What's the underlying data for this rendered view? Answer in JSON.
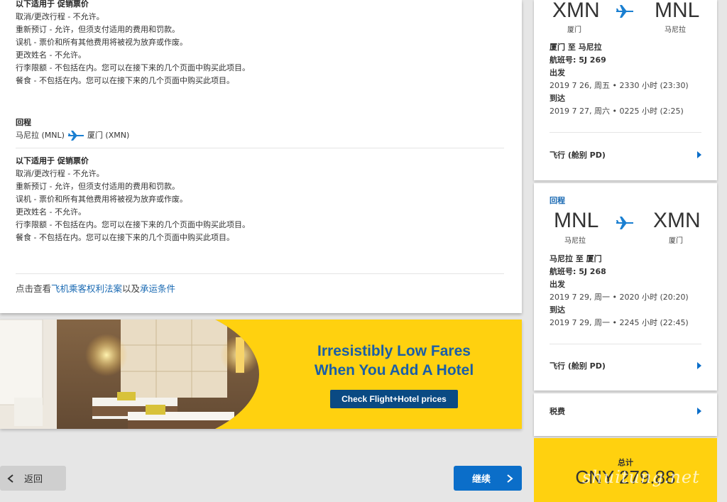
{
  "outbound_rules": {
    "title": "以下适用于 促销票价",
    "lines": [
      "取消/更改行程 - 不允许。",
      "重新预订 - 允许，但须支付适用的费用和罚款。",
      "误机 - 票价和所有其他费用将被视为放弃或作废。",
      "更改姓名 - 不允许。",
      "行李限额 - 不包括在内。您可以在接下来的几个页面中购买此项目。",
      "餐食 - 不包括在内。您可以在接下来的几个页面中购买此项目。"
    ]
  },
  "return_leg": {
    "title": "回程",
    "from": "马尼拉 (MNL)",
    "to": "厦门 (XMN)"
  },
  "return_rules": {
    "title": "以下适用于 促销票价",
    "lines": [
      "取消/更改行程 - 不允许。",
      "重新预订 - 允许，但须支付适用的费用和罚款。",
      "误机 - 票价和所有其他费用将被视为放弃或作废。",
      "更改姓名 - 不允许。",
      "行李限额 - 不包括在内。您可以在接下来的几个页面中购买此项目。",
      "餐食 - 不包括在内。您可以在接下来的几个页面中购买此项目。"
    ]
  },
  "footer": {
    "prefix": "点击查看",
    "link1": "飞机乘客权利法案",
    "middle": "以及",
    "link2": "承运条件"
  },
  "banner": {
    "line1": "Irresistibly Low Fares",
    "line2": "When You Add A Hotel",
    "cta": "Check Flight+Hotel prices"
  },
  "nav": {
    "back": "返回",
    "continue": "继续"
  },
  "summary": {
    "outbound": {
      "from_code": "XMN",
      "from_city": "厦门",
      "to_code": "MNL",
      "to_city": "马尼拉",
      "route": "厦门 至 马尼拉",
      "flight": "航班号: 5J 269",
      "depart_label": "出发",
      "depart": "2019 7 26, 周五 • 2330 小时 (23:30)",
      "arrive_label": "到达",
      "arrive": "2019 7 27, 周六 • 0225 小时 (2:25)",
      "class_label": "飞行 (舱别 PD)"
    },
    "return": {
      "label": "回程",
      "from_code": "MNL",
      "from_city": "马尼拉",
      "to_code": "XMN",
      "to_city": "厦门",
      "route": "马尼拉 至 厦门",
      "flight": "航班号: 5J 268",
      "depart_label": "出发",
      "depart": "2019 7 29, 周一 • 2020 小时 (20:20)",
      "arrive_label": "到达",
      "arrive": "2019 7 29, 周一 • 2245 小时 (22:45)",
      "class_label": "飞行 (舱别 PD)"
    },
    "taxes_label": "税费",
    "total_label": "总计",
    "total_amount": "CNY 279.88"
  },
  "watermark": "shuitung.net",
  "colors": {
    "brand_yellow": "#ffd10f",
    "brand_blue": "#0b6ec9",
    "link_blue": "#1a6ab3",
    "cta_navy": "#0a4a83"
  }
}
